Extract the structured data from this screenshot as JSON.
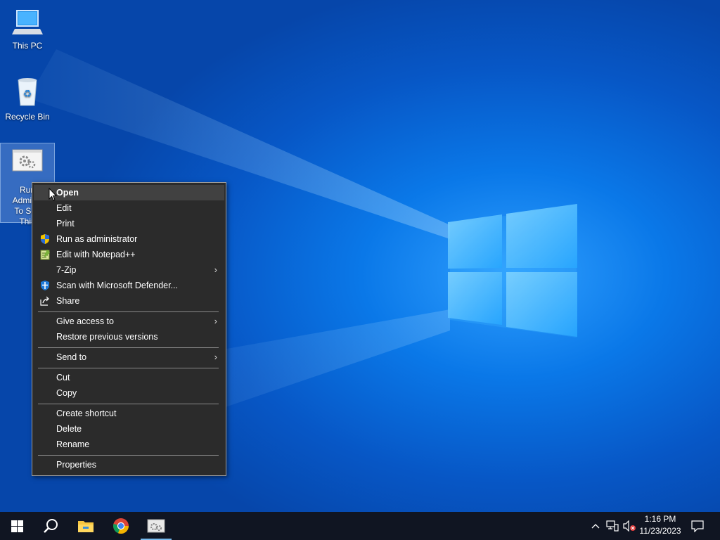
{
  "desktop": {
    "icons": [
      {
        "label": "This PC",
        "icon": "this-pc-icon"
      },
      {
        "label": "Recycle Bin",
        "icon": "recycle-bin-icon"
      },
      {
        "label_lines": [
          "Run",
          "Adminis",
          "To See",
          "Thin"
        ],
        "icon": "gears-app-icon",
        "selected": true
      }
    ]
  },
  "context_menu": {
    "items": [
      {
        "label": "Open",
        "bold": true,
        "hover": true
      },
      {
        "label": "Edit"
      },
      {
        "label": "Print"
      },
      {
        "label": "Run as administrator",
        "icon": "uac-shield-icon"
      },
      {
        "label": "Edit with Notepad++",
        "icon": "notepadpp-icon"
      },
      {
        "label": "7-Zip",
        "submenu": true
      },
      {
        "label": "Scan with Microsoft Defender...",
        "icon": "defender-shield-icon"
      },
      {
        "label": "Share",
        "icon": "share-icon"
      },
      {
        "label": "Give access to",
        "submenu": true
      },
      {
        "label": "Restore previous versions"
      },
      {
        "label": "Send to",
        "submenu": true
      },
      {
        "label": "Cut"
      },
      {
        "label": "Copy"
      },
      {
        "label": "Create shortcut"
      },
      {
        "label": "Delete"
      },
      {
        "label": "Rename"
      },
      {
        "label": "Properties"
      }
    ],
    "submenu_arrow": "›"
  },
  "taskbar": {
    "buttons": [
      "start-icon",
      "search-icon",
      "file-explorer-icon",
      "chrome-icon",
      "app-icon"
    ],
    "tray_icons": [
      "chevron-up-icon",
      "network-icon",
      "volume-muted-icon",
      "notification-icon"
    ],
    "time": "1:16 PM",
    "date": "11/23/2023"
  },
  "colors": {
    "menu_bg": "#2b2b2b",
    "menu_hover": "#414141",
    "taskbar_bg": "#101522",
    "desktop_blue": "#0a78e8"
  }
}
